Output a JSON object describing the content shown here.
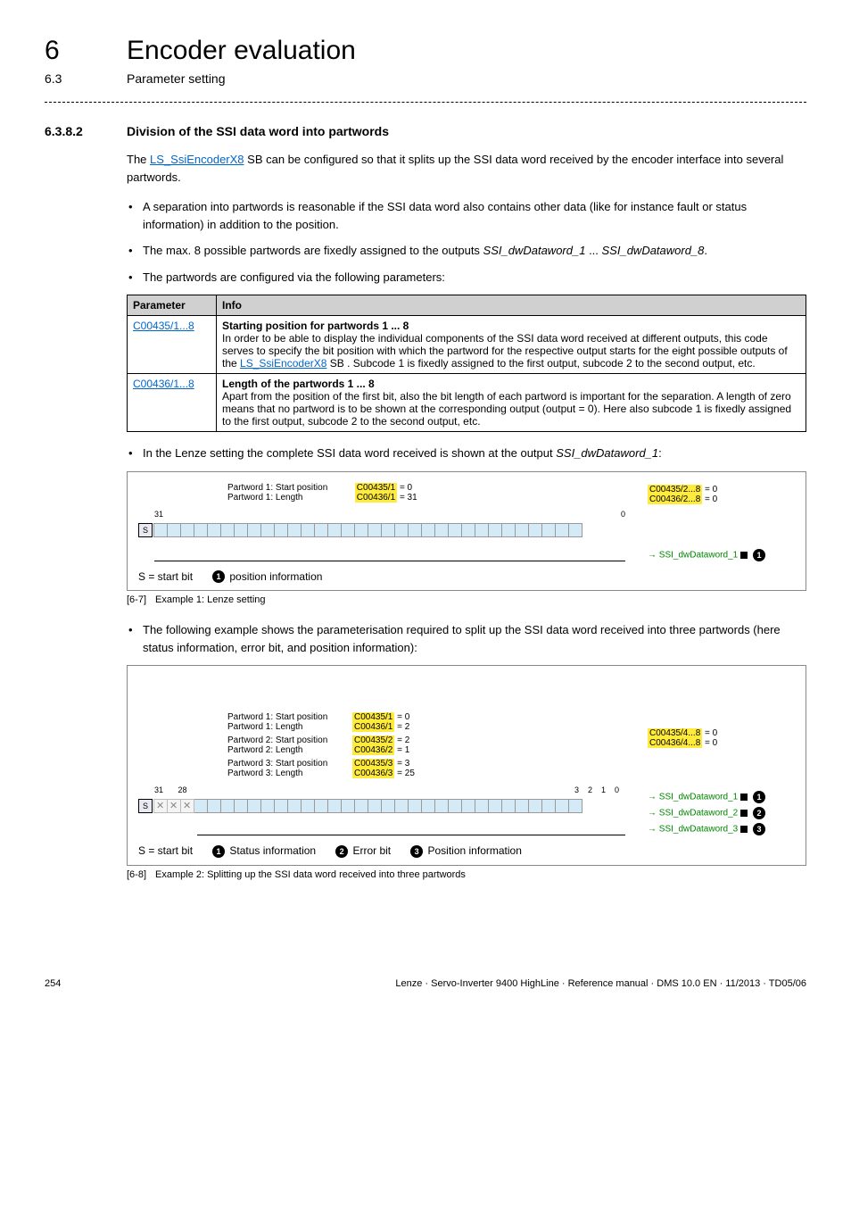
{
  "header": {
    "chapter_num": "6",
    "chapter_title": "Encoder evaluation",
    "subsection_num": "6.3",
    "subsection_title": "Parameter setting"
  },
  "section": {
    "num": "6.3.8.2",
    "title": "Division of the SSI data word into partwords"
  },
  "intro_before_link": "The ",
  "intro_link": "LS_SsiEncoderX8",
  "intro_after_link": " SB can be configured so that it splits up the SSI data word received by the encoder interface into several partwords.",
  "bullets1": [
    "A separation into partwords is reasonable if the SSI data word also contains other data (like for instance fault or status information) in addition to the position.",
    "The max. 8 possible partwords are fixedly assigned to the outputs SSI_dwDataword_1 ... SSI_dwDataword_8.",
    "The partwords are configured via the following parameters:"
  ],
  "table": {
    "headers": [
      "Parameter",
      "Info"
    ],
    "rows": [
      {
        "param": "C00435/1...8",
        "bold": "Starting position for partwords 1 ... 8",
        "text_before": "In order to be able to display the individual components of the SSI data word received at different outputs, this code serves to specify the bit position with which the partword for the respective output starts for the eight possible outputs of the ",
        "link": "LS_SsiEncoderX8",
        "text_after": " SB . Subcode 1 is fixedly assigned to the first output, subcode 2 to the second output, etc."
      },
      {
        "param": "C00436/1...8",
        "bold": "Length of the partwords 1 ... 8",
        "text_before": "Apart from the position of the first bit, also the bit length of each partword is important for the separation. A length of zero means that no partword is to be shown at the corresponding output (output = 0). Here also subcode 1 is fixedly assigned to the first output, subcode 2 to the second output, etc.",
        "link": "",
        "text_after": ""
      }
    ]
  },
  "bullet2_before": "In the Lenze setting the complete SSI data word received is shown at the output ",
  "bullet2_italic": "SSI_dwDataword_1",
  "bullet2_after": ":",
  "diagram1": {
    "labels": {
      "p1_sp_label": "Partword 1: Start position",
      "p1_sp_code": "C00435/1",
      "p1_sp_val": " = 0",
      "p1_len_label": "Partword 1: Length",
      "p1_len_code": "C00436/1",
      "p1_len_val": " = 31",
      "right1_code": "C00435/2...8",
      "right1_val": " = 0",
      "right2_code": "C00436/2...8",
      "right2_val": " = 0",
      "axis_left": "31",
      "axis_right": "0",
      "s": "S",
      "sig1": "SSI_dwDataword_1",
      "legend_s": "S = start bit",
      "legend_pos": " position information"
    }
  },
  "caption1_label": "[6-7]",
  "caption1_text": "Example 1: Lenze setting",
  "bullet3": "The following example shows the parameterisation required to split up the SSI data word received into three partwords (here status information, error bit, and position information):",
  "diagram2": {
    "labels": {
      "p1_sp_label": "Partword 1: Start position",
      "p1_sp_code": "C00435/1",
      "p1_sp_val": " = 0",
      "p1_len_label": "Partword 1: Length",
      "p1_len_code": "C00436/1",
      "p1_len_val": " = 2",
      "p2_sp_label": "Partword 2: Start position",
      "p2_sp_code": "C00435/2",
      "p2_sp_val": " = 2",
      "p2_len_label": "Partword 2: Length",
      "p2_len_code": "C00436/2",
      "p2_len_val": " = 1",
      "p3_sp_label": "Partword 3: Start position",
      "p3_sp_code": "C00435/3",
      "p3_sp_val": " = 3",
      "p3_len_label": "Partword 3: Length",
      "p3_len_code": "C00436/3",
      "p3_len_val": " = 25",
      "right1_code": "C00435/4...8",
      "right1_val": " = 0",
      "right2_code": "C00436/4...8",
      "right2_val": " = 0",
      "axis_31": "31",
      "axis_28": "28",
      "axis_3": "3",
      "axis_2": "2",
      "axis_1": "1",
      "axis_0": "0",
      "s": "S",
      "sig1": "SSI_dwDataword_1",
      "sig2": "SSI_dwDataword_2",
      "sig3": "SSI_dwDataword_3",
      "legend_s": "S = start bit",
      "legend_status": " Status information",
      "legend_error": " Error bit",
      "legend_pos": " Position information"
    }
  },
  "caption2_label": "[6-8]",
  "caption2_text": "Example 2: Splitting up the SSI data word received into three partwords",
  "footer": {
    "page": "254",
    "doc": "Lenze · Servo-Inverter 9400 HighLine · Reference manual · DMS 10.0 EN · 11/2013 · TD05/06"
  }
}
